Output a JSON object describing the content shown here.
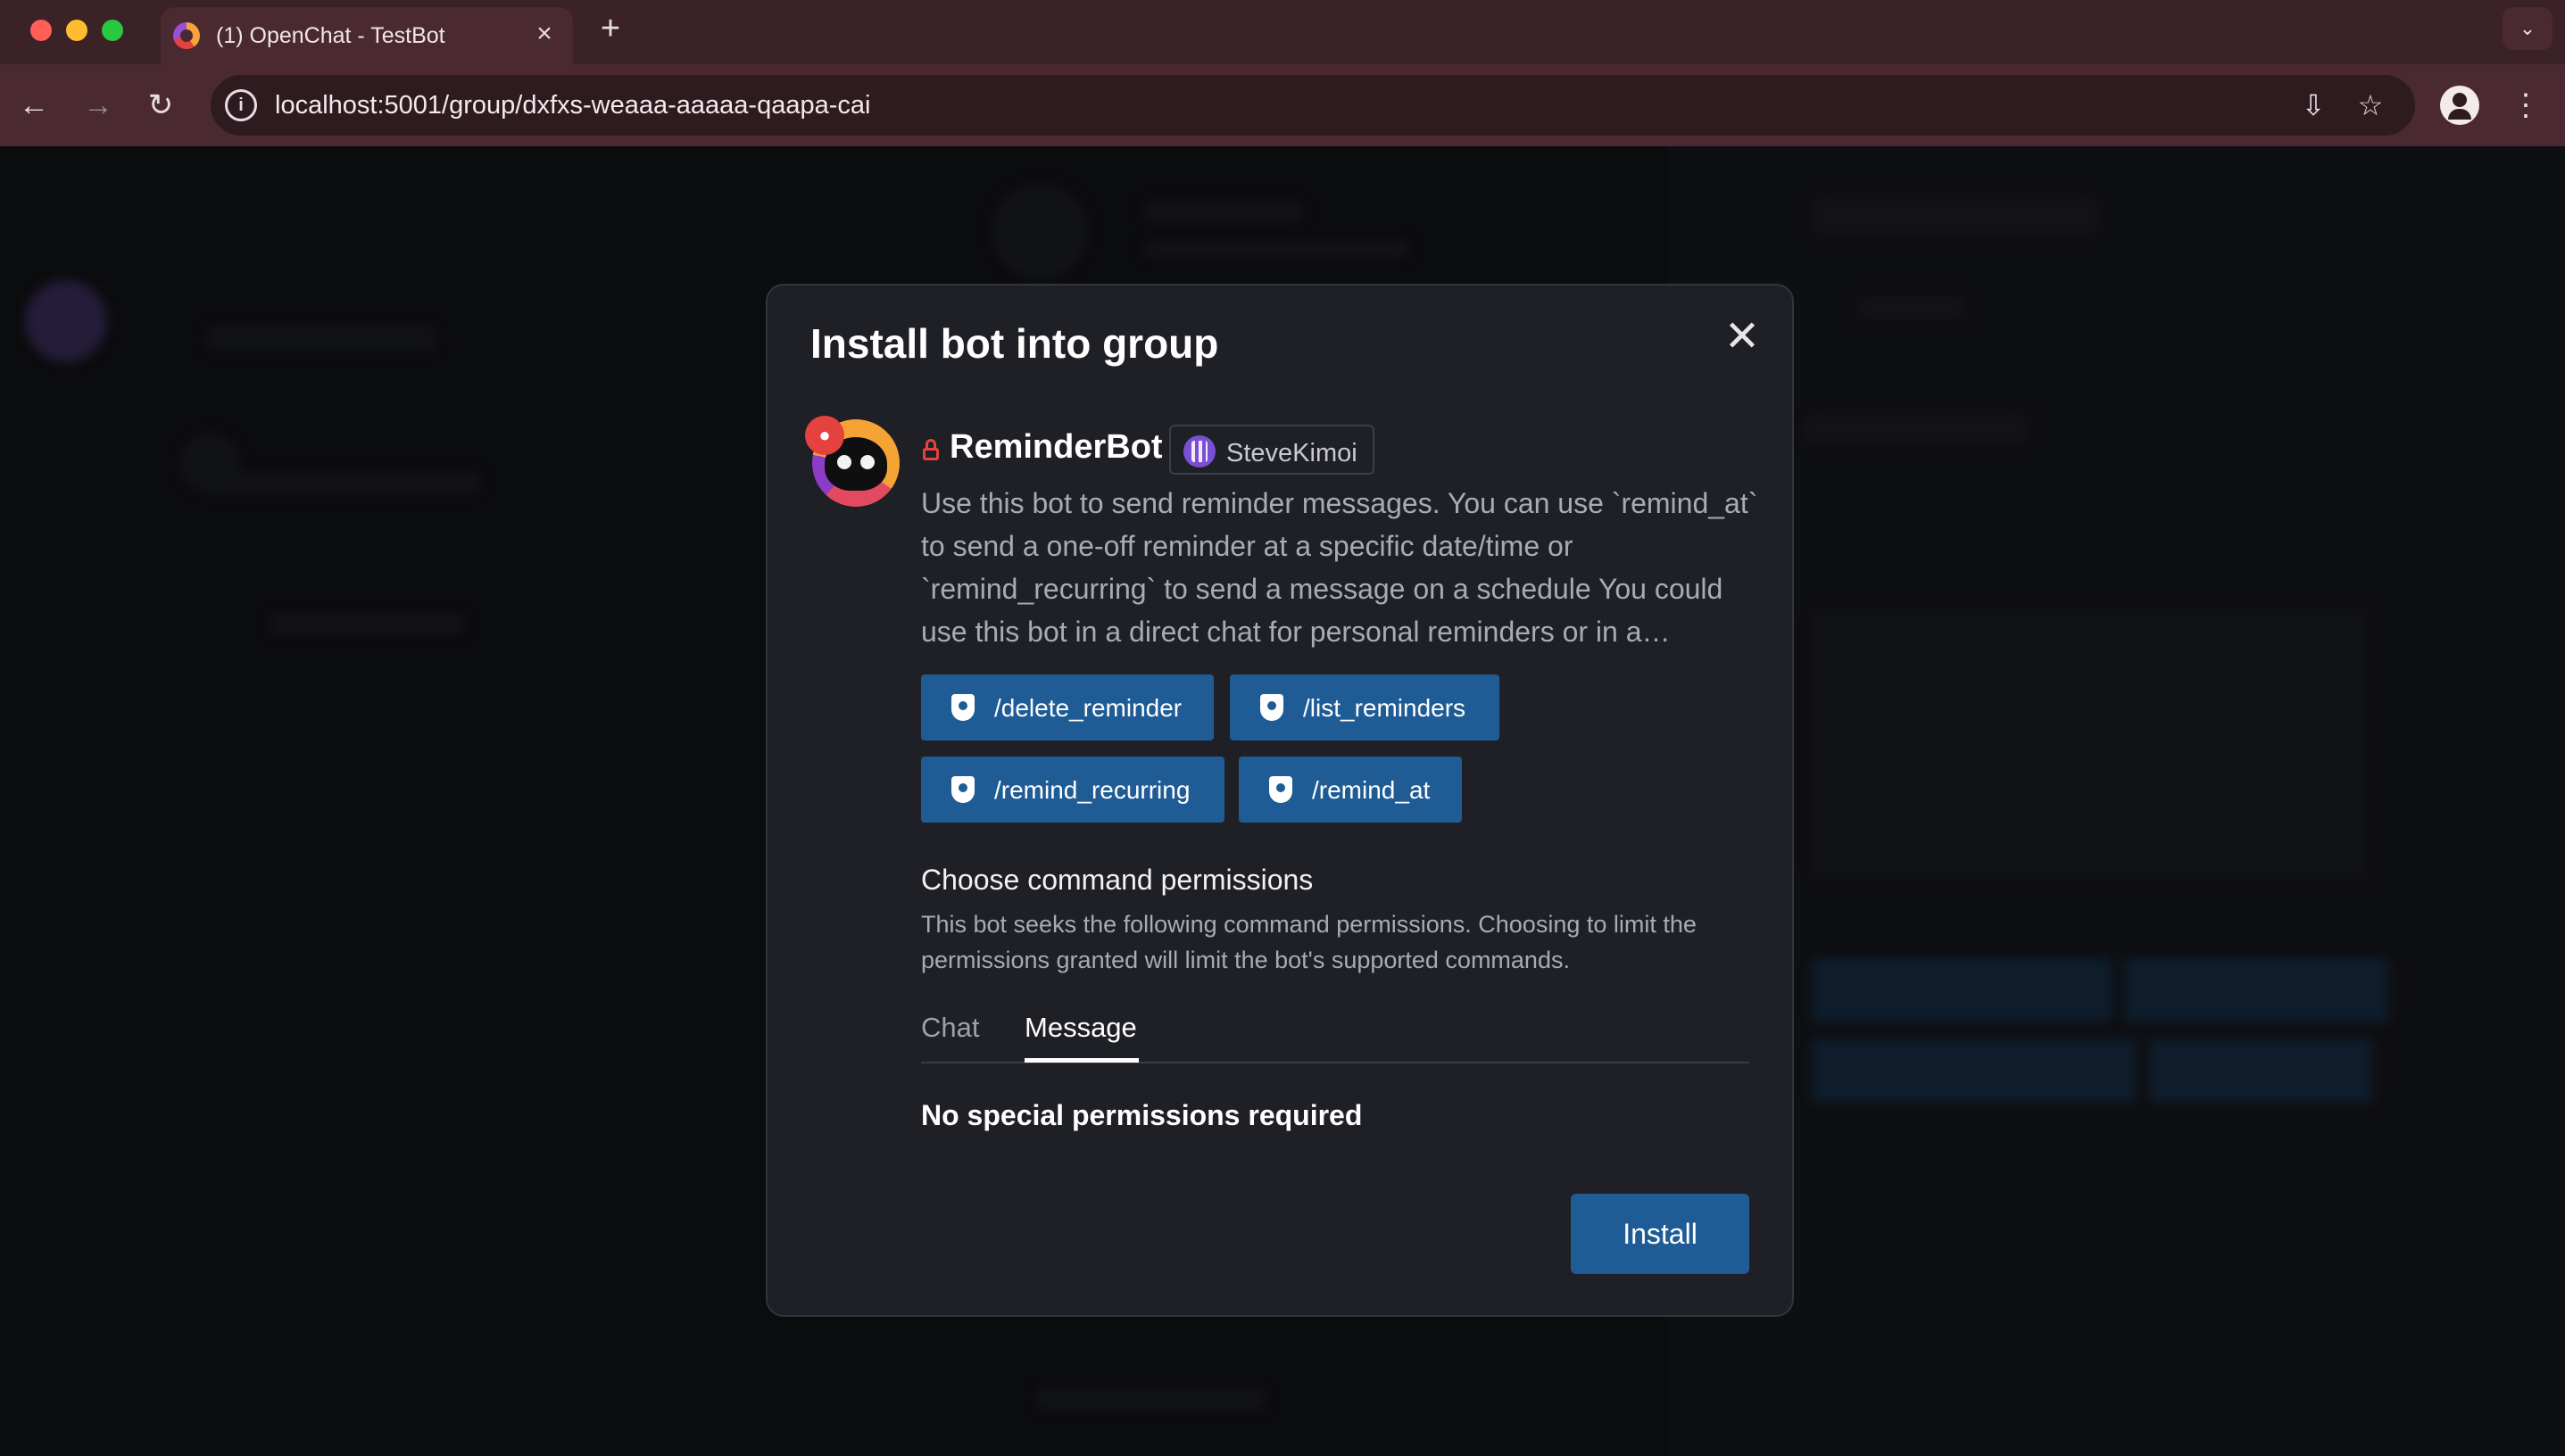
{
  "browser": {
    "tab_title": "(1) OpenChat - TestBot",
    "tab_close": "×",
    "new_tab": "+",
    "url": "localhost:5001/group/dxfxs-weaaa-aaaaa-qaapa-cai",
    "back": "←",
    "forward": "→",
    "reload": "↻",
    "site_info": "i",
    "install_app": "⇩",
    "bookmark": "☆",
    "menu": "⋮",
    "tabs_menu": "⌄"
  },
  "modal": {
    "title": "Install bot into group",
    "close": "✕",
    "bot_name": "ReminderBot",
    "owner": "SteveKimoi",
    "description": "Use this bot to send reminder messages. You can use `remind_at` to send a one-off reminder at a specific date/time or `remind_recurring` to send a message on a schedule You could use this bot in a direct chat for personal reminders or in a…",
    "commands": [
      "/delete_reminder",
      "/list_reminders",
      "/remind_recurring",
      "/remind_at"
    ],
    "permissions_heading": "Choose command permissions",
    "permissions_desc": "This bot seeks the following command permissions. Choosing to limit the permissions granted will limit the bot's supported commands.",
    "tabs": [
      "Chat",
      "Message"
    ],
    "active_tab": "Message",
    "no_permissions": "No special permissions required",
    "install_label": "Install"
  },
  "colors": {
    "accent": "#1f5c96",
    "danger": "#e5413f",
    "modal_bg": "#1f2026"
  }
}
